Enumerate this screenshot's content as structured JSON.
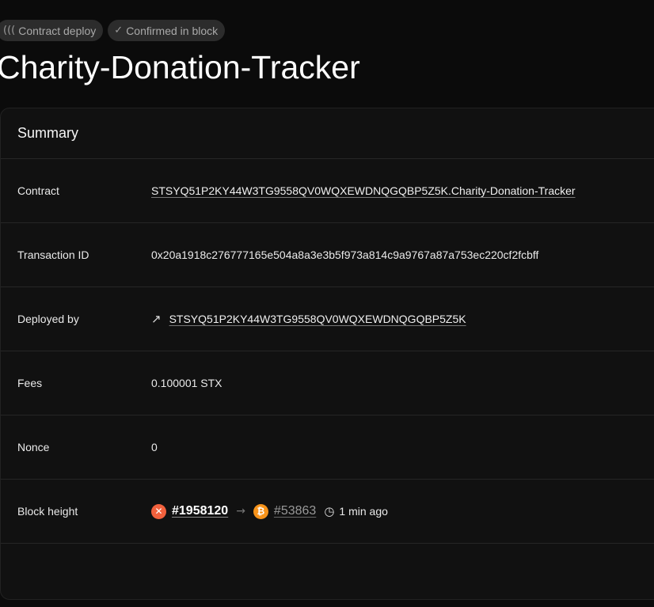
{
  "badges": [
    {
      "icon": "function-icon",
      "glyph": "(((",
      "label": "Contract deploy"
    },
    {
      "icon": "check-icon",
      "glyph": "✓",
      "label": "Confirmed in block"
    }
  ],
  "title": "Charity-Donation-Tracker",
  "summary": {
    "heading": "Summary",
    "contract": {
      "label": "Contract",
      "value": "STSYQ51P2KY44W3TG9558QV0WQXEWDNQGQBP5Z5K.Charity-Donation-Tracker"
    },
    "transaction_id": {
      "label": "Transaction ID",
      "value": "0x20a1918c276777165e504a8a3e3b5f973a814c9a9767a87a753ec220cf2fcbff"
    },
    "deployed_by": {
      "label": "Deployed by",
      "value": "STSYQ51P2KY44W3TG9558QV0WQXEWDNQGQBP5Z5K"
    },
    "fees": {
      "label": "Fees",
      "value": "0.100001 STX"
    },
    "nonce": {
      "label": "Nonce",
      "value": "0"
    },
    "block_height": {
      "label": "Block height",
      "stx_block": "#1958120",
      "btc_block": "#53863",
      "time_ago": "1 min ago"
    }
  },
  "colors": {
    "stx": "#f2613d",
    "btc": "#f7931a",
    "background": "#0b0b0b"
  }
}
